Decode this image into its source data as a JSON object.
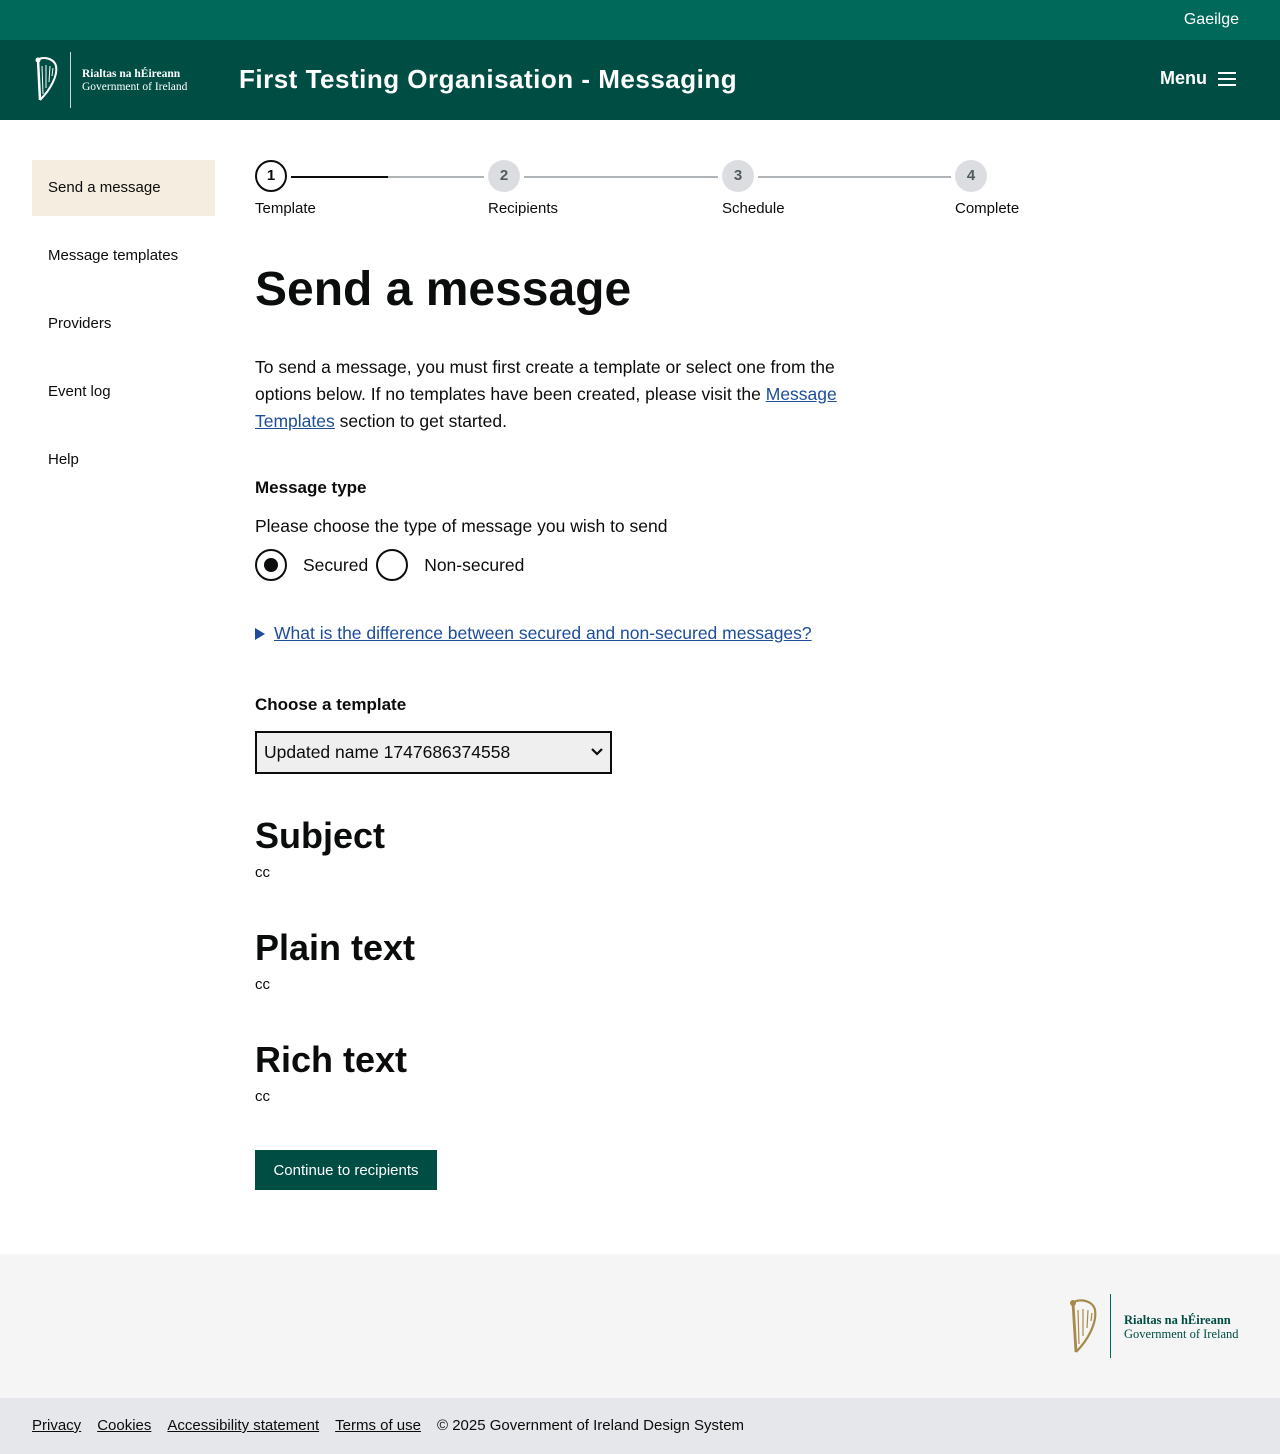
{
  "topbar": {
    "language_link": "Gaeilge"
  },
  "header": {
    "logo_line1": "Rialtas na hÉireann",
    "logo_line2": "Government of Ireland",
    "title": "First Testing Organisation - Messaging",
    "menu_label": "Menu"
  },
  "sidebar": {
    "items": [
      {
        "label": "Send a message",
        "active": true
      },
      {
        "label": "Message templates",
        "active": false
      },
      {
        "label": "Providers",
        "active": false
      },
      {
        "label": "Event log",
        "active": false
      },
      {
        "label": "Help",
        "active": false
      }
    ]
  },
  "stepper": {
    "current_step": 1,
    "steps": [
      {
        "number": "1",
        "label": "Template"
      },
      {
        "number": "2",
        "label": "Recipients"
      },
      {
        "number": "3",
        "label": "Schedule"
      },
      {
        "number": "4",
        "label": "Complete"
      }
    ]
  },
  "main": {
    "heading": "Send a message",
    "intro_before": "To send a message, you must first create a template or select one from the options below. If no templates have been created, please visit the ",
    "intro_link": "Message Templates",
    "intro_after": " section to get started.",
    "message_type_label": "Message type",
    "message_type_hint": "Please choose the type of message you wish to send",
    "radio_options": [
      {
        "label": "Secured",
        "selected": true
      },
      {
        "label": "Non-secured",
        "selected": false
      }
    ],
    "details_summary": "What is the difference between secured and non-secured messages?",
    "template_label": "Choose a template",
    "template_selected": "Updated name 1747686374558",
    "subject_heading": "Subject",
    "subject_value": "cc",
    "plain_heading": "Plain text",
    "plain_value": "cc",
    "rich_heading": "Rich text",
    "rich_value": "cc",
    "continue_button": "Continue to recipients"
  },
  "footer": {
    "logo_line1": "Rialtas na hÉireann",
    "logo_line2": "Government of Ireland",
    "links": [
      "Privacy",
      "Cookies",
      "Accessibility statement",
      "Terms of use"
    ],
    "copyright": "© 2025 Government of Ireland Design System"
  },
  "colors": {
    "topbar": "#00695a",
    "header": "#004d44",
    "sidebar_active": "#f5ede0",
    "link": "#1d4d9a",
    "footer_top": "#f5f5f5",
    "footer_bottom": "#e6e7ea"
  }
}
